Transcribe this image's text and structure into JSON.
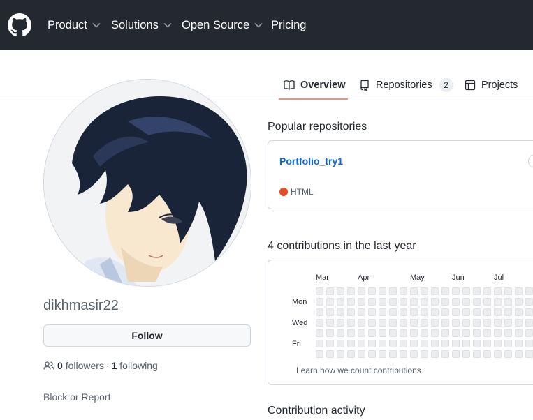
{
  "header": {
    "nav": [
      {
        "label": "Product",
        "has_dropdown": true
      },
      {
        "label": "Solutions",
        "has_dropdown": true
      },
      {
        "label": "Open Source",
        "has_dropdown": true
      },
      {
        "label": "Pricing",
        "has_dropdown": false
      }
    ],
    "logo_icon": "github-mark-icon"
  },
  "tabs": [
    {
      "label": "Overview",
      "icon": "book-icon",
      "active": true
    },
    {
      "label": "Repositories",
      "icon": "repo-icon",
      "count": "2"
    },
    {
      "label": "Projects",
      "icon": "table-icon"
    }
  ],
  "profile": {
    "username": "dikhmasir22",
    "follow_label": "Follow",
    "followers_count": "0",
    "followers_label": "followers",
    "separator": "·",
    "following_count": "1",
    "following_label": "following",
    "block_report": "Block or Report"
  },
  "popular": {
    "title": "Popular repositories",
    "repos": [
      {
        "name": "Portfolio_try1",
        "language": "HTML",
        "language_color": "#e34c26"
      }
    ]
  },
  "contributions": {
    "title": "4 contributions in the last year",
    "months": [
      "Mar",
      "Apr",
      "May",
      "Jun",
      "Jul"
    ],
    "weekdays": [
      "Mon",
      "Wed",
      "Fri"
    ],
    "learn_link": "Learn how we count contributions",
    "cell_color": "#ebedf0"
  },
  "activity": {
    "title": "Contribution activity"
  },
  "colors": {
    "header_bg": "#24292f",
    "accent_link": "#0969da",
    "tab_underline": "#fd8c73"
  }
}
